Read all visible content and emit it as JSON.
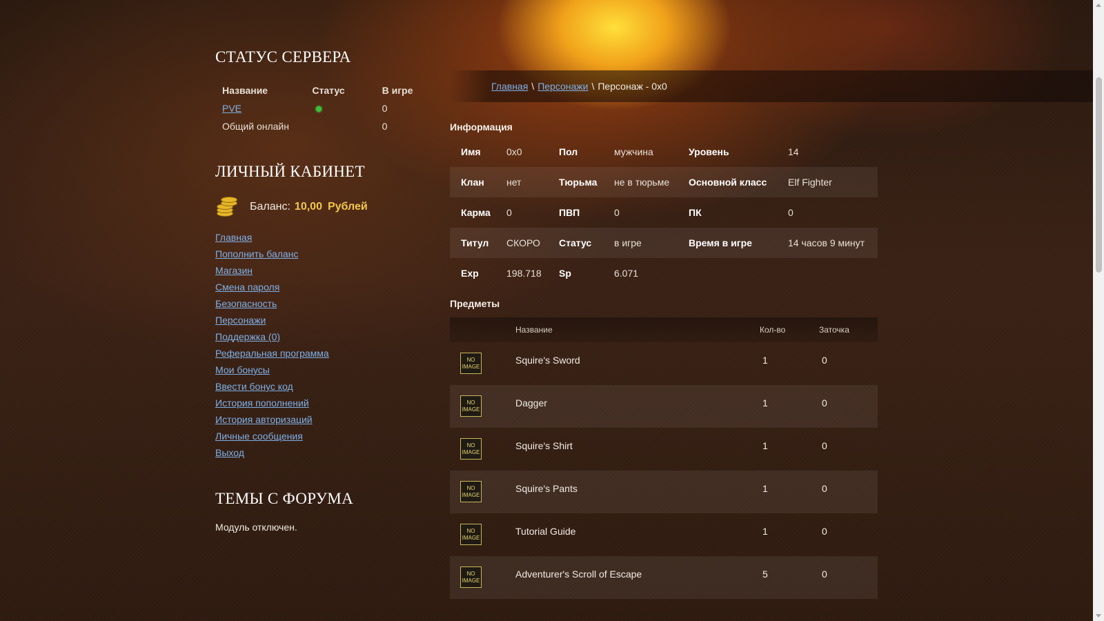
{
  "server_status": {
    "title": "СТАТУС СЕРВЕРА",
    "headers": [
      "Название",
      "Статус",
      "В игре"
    ],
    "rows": [
      {
        "name": "PVE",
        "status": "online",
        "in_game": "0"
      },
      {
        "name": "Общий онлайн",
        "in_game": "0"
      }
    ]
  },
  "cabinet": {
    "title": "ЛИЧНЫЙ КАБИНЕТ",
    "balance_label": "Баланс:",
    "balance_value": "10,00",
    "currency": "Рублей",
    "menu": [
      "Главная",
      "Пополнить баланс",
      "Магазин",
      "Смена пароля",
      "Безопасность",
      "Персонажи",
      "Поддержка (0)",
      "Реферальная программа",
      "Мои бонусы",
      "Ввести бонус код",
      "История пополнений",
      "История авторизаций",
      "Личные сообщения",
      "Выход"
    ]
  },
  "forum": {
    "title": "ТЕМЫ С ФОРУМА",
    "text": "Модуль отключен."
  },
  "breadcrumb": {
    "home": "Главная",
    "characters": "Персонажи",
    "separator": "\\",
    "current": "Персонаж - 0x0"
  },
  "info": {
    "title": "Информация",
    "rows": [
      [
        [
          "Имя",
          "0x0"
        ],
        [
          "Пол",
          "мужчина"
        ],
        [
          "Уровень",
          "14"
        ]
      ],
      [
        [
          "Клан",
          "нет"
        ],
        [
          "Тюрьма",
          "не в тюрьме"
        ],
        [
          "Основной класс",
          "Elf Fighter"
        ]
      ],
      [
        [
          "Карма",
          "0"
        ],
        [
          "ПВП",
          "0"
        ],
        [
          "ПК",
          "0"
        ]
      ],
      [
        [
          "Титул",
          "СКОРО"
        ],
        [
          "Статус",
          "в игре"
        ],
        [
          "Время в игре",
          "14 часов 9 минут"
        ]
      ],
      [
        [
          "Exp",
          "198.718"
        ],
        [
          "Sp",
          "6.071"
        ]
      ]
    ]
  },
  "items": {
    "title": "Предметы",
    "headers": {
      "name": "Название",
      "qty": "Кол-во",
      "enchant": "Заточка"
    },
    "no_image": "NO IMAGE",
    "rows": [
      {
        "name": "Squire's Sword",
        "qty": "1",
        "enchant": "0"
      },
      {
        "name": "Dagger",
        "qty": "1",
        "enchant": "0"
      },
      {
        "name": "Squire's Shirt",
        "qty": "1",
        "enchant": "0"
      },
      {
        "name": "Squire's Pants",
        "qty": "1",
        "enchant": "0"
      },
      {
        "name": "Tutorial Guide",
        "qty": "1",
        "enchant": "0"
      },
      {
        "name": "Adventurer's Scroll of Escape",
        "qty": "5",
        "enchant": "0"
      }
    ]
  },
  "colors": {
    "link": "#7fb0e6",
    "balance": "#f3c84b",
    "online": "#36c23a"
  }
}
